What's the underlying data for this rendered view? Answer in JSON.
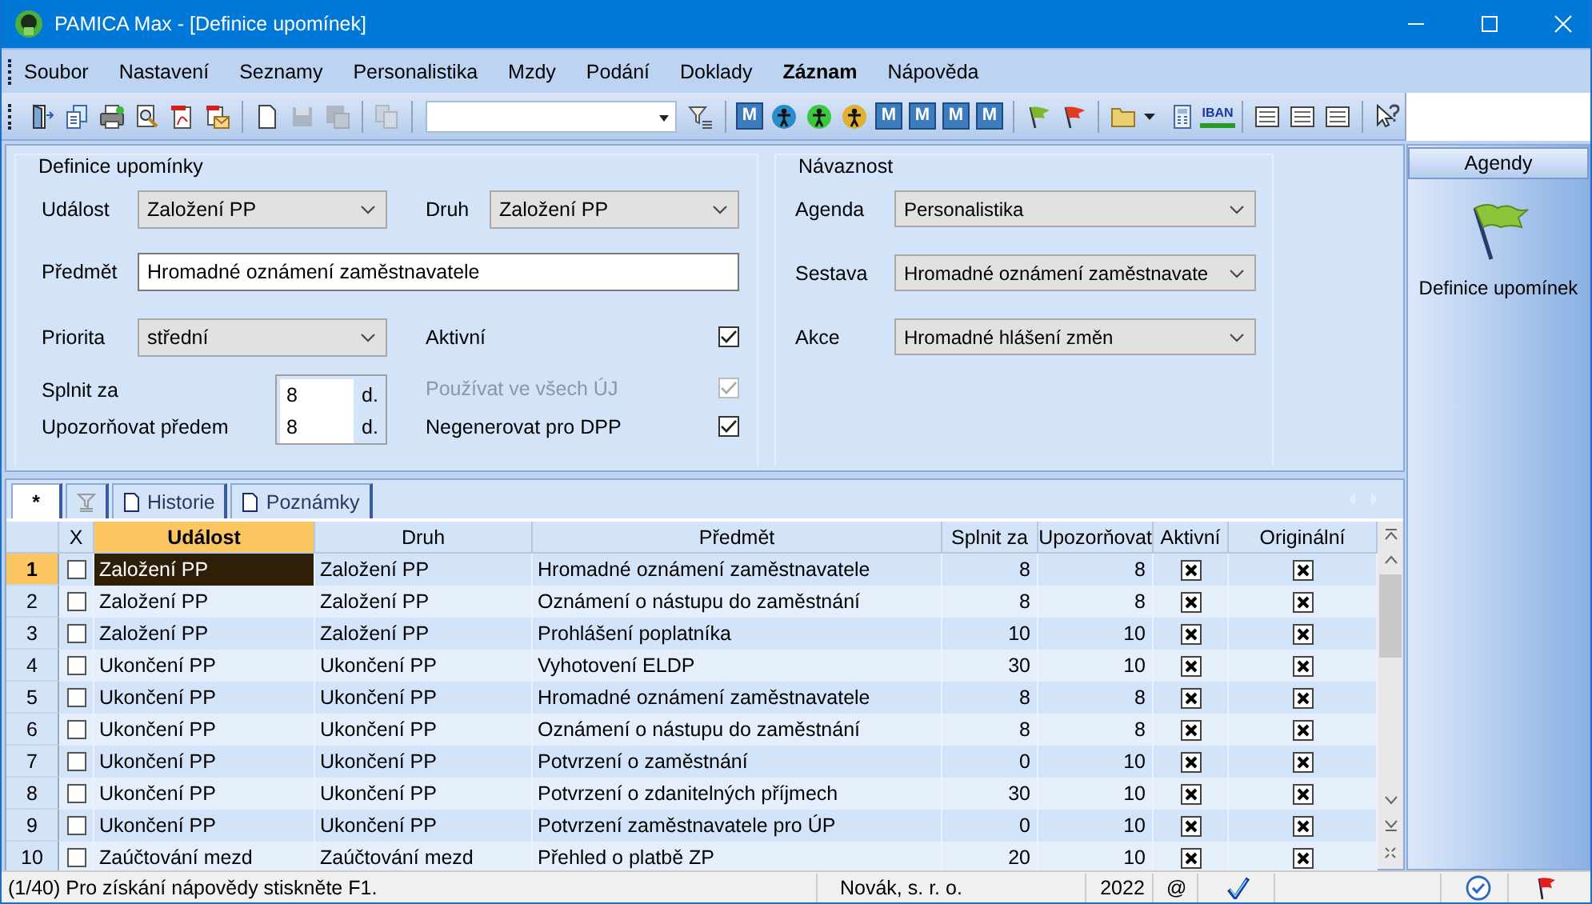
{
  "window": {
    "title": "PAMICA Max - [Definice upomínek]"
  },
  "menu": [
    {
      "label": "Soubor",
      "bold": false
    },
    {
      "label": "Nastavení",
      "bold": false
    },
    {
      "label": "Seznamy",
      "bold": false
    },
    {
      "label": "Personalistika",
      "bold": false
    },
    {
      "label": "Mzdy",
      "bold": false
    },
    {
      "label": "Podání",
      "bold": false
    },
    {
      "label": "Doklady",
      "bold": false
    },
    {
      "label": "Záznam",
      "bold": true
    },
    {
      "label": "Nápověda",
      "bold": false
    }
  ],
  "toolbar": [
    {
      "kind": "door",
      "disabled": false
    },
    {
      "kind": "docs",
      "disabled": false
    },
    {
      "kind": "printer",
      "disabled": false
    },
    {
      "kind": "preview",
      "disabled": false
    },
    {
      "kind": "pdf",
      "disabled": false
    },
    {
      "kind": "pdfmail",
      "disabled": false
    },
    {
      "kind": "sep"
    },
    {
      "kind": "newdoc",
      "disabled": false
    },
    {
      "kind": "save",
      "disabled": true
    },
    {
      "kind": "saveas",
      "disabled": true
    },
    {
      "kind": "sep"
    },
    {
      "kind": "copy",
      "disabled": true
    },
    {
      "kind": "sep"
    },
    {
      "kind": "combo"
    },
    {
      "kind": "filter",
      "disabled": false
    },
    {
      "kind": "sep"
    },
    {
      "kind": "mtile",
      "label": "M",
      "disabled": false
    },
    {
      "kind": "person",
      "color": "#2a8cc8",
      "disabled": false
    },
    {
      "kind": "person",
      "color": "#3cc83c",
      "disabled": false
    },
    {
      "kind": "person",
      "color": "#e0b030",
      "disabled": false
    },
    {
      "kind": "mtile",
      "label": "M",
      "disabled": false
    },
    {
      "kind": "mtile",
      "label": "M",
      "disabled": false
    },
    {
      "kind": "mtile",
      "label": "M",
      "disabled": false
    },
    {
      "kind": "mtile",
      "label": "M",
      "disabled": false
    },
    {
      "kind": "sep"
    },
    {
      "kind": "flag",
      "color": "#7cb82a",
      "disabled": false
    },
    {
      "kind": "flag",
      "color": "#e03a20",
      "disabled": false
    },
    {
      "kind": "sep"
    },
    {
      "kind": "folder",
      "disabled": false
    },
    {
      "kind": "calculator",
      "disabled": false
    },
    {
      "kind": "iban",
      "label": "IBAN",
      "disabled": false
    },
    {
      "kind": "sep"
    },
    {
      "kind": "list",
      "disabled": false
    },
    {
      "kind": "list",
      "disabled": false
    },
    {
      "kind": "list",
      "disabled": false
    },
    {
      "kind": "sep"
    },
    {
      "kind": "help",
      "disabled": false
    }
  ],
  "definition": {
    "title": "Definice upomínky",
    "event": {
      "label": "Událost",
      "value": "Založení PP"
    },
    "type": {
      "label": "Druh",
      "value": "Založení PP"
    },
    "subject": {
      "label": "Předmět",
      "value": "Hromadné oznámení zaměstnavatele"
    },
    "priority": {
      "label": "Priorita",
      "value": "střední"
    },
    "active": {
      "label": "Aktivní",
      "checked": true,
      "disabled": false
    },
    "complete_in": {
      "label": "Splnit za",
      "value": "8",
      "unit": "d."
    },
    "remind_before": {
      "label": "Upozorňovat předem",
      "value": "8",
      "unit": "d."
    },
    "all_units": {
      "label": "Používat ve všech ÚJ",
      "checked": true,
      "disabled": true
    },
    "no_dpp": {
      "label": "Negenerovat pro DPP",
      "checked": true,
      "disabled": false
    }
  },
  "link": {
    "title": "Návaznost",
    "fields": [
      {
        "label": "Agenda",
        "value": "Personalistika"
      },
      {
        "label": "Sestava",
        "value": "Hromadné oznámení zaměstnavate"
      },
      {
        "label": "Akce",
        "value": "Hromadné hlášení změn"
      }
    ]
  },
  "agendas": {
    "header": "Agendy",
    "item": "Definice upomínek"
  },
  "tabs": [
    {
      "kind": "text",
      "label": "*",
      "selected": true
    },
    {
      "kind": "filter",
      "selected": false
    },
    {
      "kind": "doc",
      "label": "Historie",
      "selected": false
    },
    {
      "kind": "doc",
      "label": "Poznámky",
      "selected": false
    }
  ],
  "table": {
    "columns": [
      {
        "label": "X",
        "sorted": false
      },
      {
        "label": "Událost",
        "sorted": true
      },
      {
        "label": "Druh",
        "sorted": false
      },
      {
        "label": "Předmět",
        "sorted": false
      },
      {
        "label": "Splnit za",
        "sorted": false
      },
      {
        "label": "Upozorňovat",
        "sorted": false
      },
      {
        "label": "Aktivní",
        "sorted": false
      },
      {
        "label": "Originální",
        "sorted": false
      }
    ],
    "rows": [
      {
        "number": "1",
        "selected": true,
        "marked": false,
        "event": "Založení PP",
        "type": "Založení PP",
        "subject": "Hromadné oznámení zaměstnavatele",
        "complete_in": "8",
        "remind": "8",
        "active": true,
        "original": true
      },
      {
        "number": "2",
        "selected": false,
        "marked": false,
        "event": "Založení PP",
        "type": "Založení PP",
        "subject": "Oznámení o nástupu do zaměstnání",
        "complete_in": "8",
        "remind": "8",
        "active": true,
        "original": true
      },
      {
        "number": "3",
        "selected": false,
        "marked": false,
        "event": "Založení PP",
        "type": "Založení PP",
        "subject": "Prohlášení poplatníka",
        "complete_in": "10",
        "remind": "10",
        "active": true,
        "original": true
      },
      {
        "number": "4",
        "selected": false,
        "marked": false,
        "event": "Ukončení PP",
        "type": "Ukončení PP",
        "subject": "Vyhotovení ELDP",
        "complete_in": "30",
        "remind": "10",
        "active": true,
        "original": true
      },
      {
        "number": "5",
        "selected": false,
        "marked": false,
        "event": "Ukončení PP",
        "type": "Ukončení PP",
        "subject": "Hromadné oznámení zaměstnavatele",
        "complete_in": "8",
        "remind": "8",
        "active": true,
        "original": true
      },
      {
        "number": "6",
        "selected": false,
        "marked": false,
        "event": "Ukončení PP",
        "type": "Ukončení PP",
        "subject": "Oznámení o nástupu do zaměstnání",
        "complete_in": "8",
        "remind": "8",
        "active": true,
        "original": true
      },
      {
        "number": "7",
        "selected": false,
        "marked": false,
        "event": "Ukončení PP",
        "type": "Ukončení PP",
        "subject": "Potvrzení o zaměstnání",
        "complete_in": "0",
        "remind": "10",
        "active": true,
        "original": true
      },
      {
        "number": "8",
        "selected": false,
        "marked": false,
        "event": "Ukončení PP",
        "type": "Ukončení PP",
        "subject": "Potvrzení o zdanitelných příjmech",
        "complete_in": "30",
        "remind": "10",
        "active": true,
        "original": true
      },
      {
        "number": "9",
        "selected": false,
        "marked": false,
        "event": "Ukončení PP",
        "type": "Ukončení PP",
        "subject": "Potvrzení zaměstnavatele pro ÚP",
        "complete_in": "0",
        "remind": "10",
        "active": true,
        "original": true
      },
      {
        "number": "10",
        "selected": false,
        "marked": false,
        "event": "Zaúčtování mezd",
        "type": "Zaúčtování mezd",
        "subject": "Přehled o platbě ZP",
        "complete_in": "20",
        "remind": "10",
        "active": true,
        "original": true
      }
    ]
  },
  "status_bar": {
    "message": "(1/40) Pro získání nápovědy stiskněte F1.",
    "company": "Novák, s. r. o.",
    "year": "2022",
    "mail": "@"
  }
}
